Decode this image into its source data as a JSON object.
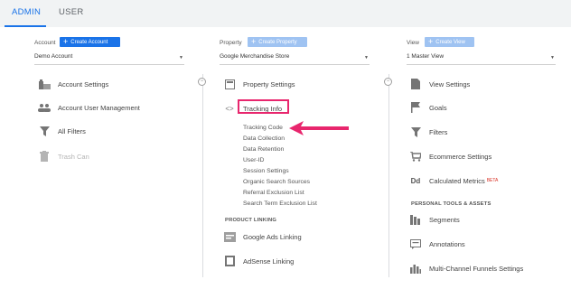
{
  "tabs": {
    "admin": "ADMIN",
    "user": "USER"
  },
  "account": {
    "label": "Account",
    "create": "Create Account",
    "selected": "Demo Account",
    "items": [
      {
        "label": "Account Settings",
        "icon": "building-icon"
      },
      {
        "label": "Account User Management",
        "icon": "users-icon"
      },
      {
        "label": "All Filters",
        "icon": "filter-icon"
      },
      {
        "label": "Trash Can",
        "icon": "trash-icon"
      }
    ]
  },
  "property": {
    "label": "Property",
    "create": "Create Property",
    "selected": "Google Merchandise Store",
    "items": [
      {
        "label": "Property Settings",
        "icon": "settings-page-icon"
      },
      {
        "label": "Tracking Info",
        "icon": "code-icon"
      }
    ],
    "tracking_sub": [
      "Tracking Code",
      "Data Collection",
      "Data Retention",
      "User-ID",
      "Session Settings",
      "Organic Search Sources",
      "Referral Exclusion List",
      "Search Term Exclusion List"
    ],
    "product_linking_heading": "PRODUCT LINKING",
    "linking": [
      {
        "label": "Google Ads Linking",
        "icon": "google-ads-icon"
      },
      {
        "label": "AdSense Linking",
        "icon": "adsense-icon"
      }
    ]
  },
  "view": {
    "label": "View",
    "create": "Create View",
    "selected": "1 Master View",
    "items": [
      {
        "label": "View Settings",
        "icon": "document-icon"
      },
      {
        "label": "Goals",
        "icon": "flag-icon"
      },
      {
        "label": "Filters",
        "icon": "filter-icon"
      },
      {
        "label": "Ecommerce Settings",
        "icon": "cart-icon"
      },
      {
        "label": "Calculated Metrics",
        "icon": "dd-icon",
        "badge": "BETA"
      }
    ],
    "personal_heading": "PERSONAL TOOLS & ASSETS",
    "personal": [
      {
        "label": "Segments",
        "icon": "segments-icon"
      },
      {
        "label": "Annotations",
        "icon": "annotations-icon"
      },
      {
        "label": "Multi-Channel Funnels Settings",
        "icon": "bar-chart-icon"
      }
    ]
  },
  "colors": {
    "accent": "#1a73e8",
    "highlight": "#e8266d"
  }
}
